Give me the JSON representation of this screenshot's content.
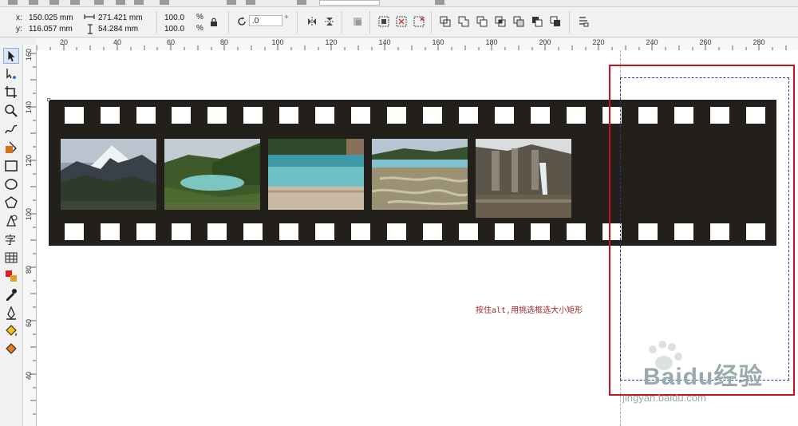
{
  "properties": {
    "x_label": "x:",
    "x_value": "150.025 mm",
    "y_label": "y:",
    "y_value": "116.057 mm",
    "width_value": "271.421 mm",
    "height_value": "54.284 mm",
    "scale_x": "100.0",
    "scale_y": "100.0",
    "percent_symbol": "%",
    "rotation_value": ".0",
    "degree_symbol": "°"
  },
  "ruler_h": {
    "labels": [
      "20",
      "40",
      "60",
      "80",
      "100",
      "120",
      "140",
      "160",
      "180",
      "200",
      "220",
      "240",
      "260",
      "280"
    ]
  },
  "ruler_v": {
    "labels": [
      "160",
      "140",
      "120",
      "100",
      "80",
      "60",
      "40"
    ]
  },
  "annotation": {
    "text": "按住alt,用挑选框选大小矩形"
  },
  "watermark": {
    "text": "Baidu经验",
    "sub": "jingyan.baidu.com"
  },
  "colors": {
    "film": "#231f1b",
    "selection_red": "#c5141c",
    "annotation": "#a0262a"
  },
  "icons": {
    "lock": "lock-icon",
    "rotate": "rotate-icon",
    "pick_tool": "pick-tool-icon",
    "text_tool": "text-tool-icon"
  }
}
